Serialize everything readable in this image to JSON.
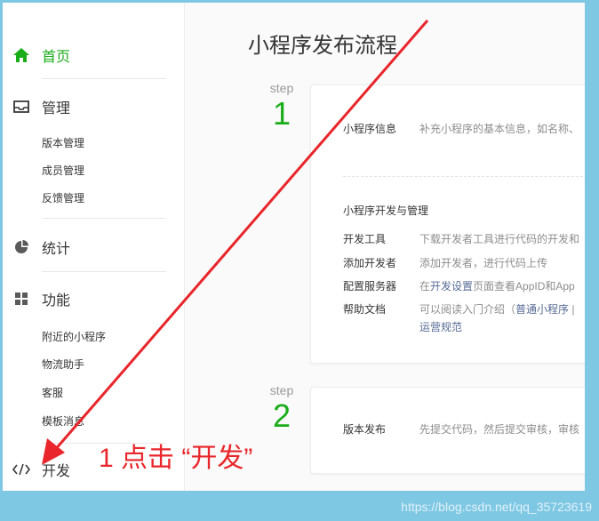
{
  "sidebar": {
    "home": {
      "label": "首页",
      "icon": "home-icon"
    },
    "manage": {
      "label": "管理",
      "icon": "inbox-icon"
    },
    "manage_items": [
      "版本管理",
      "成员管理",
      "反馈管理"
    ],
    "stats": {
      "label": "统计",
      "icon": "pie-chart-icon"
    },
    "features": {
      "label": "功能",
      "icon": "grid-icon"
    },
    "feature_items": [
      "附近的小程序",
      "物流助手",
      "客服",
      "模板消息"
    ],
    "develop": {
      "label": "开发",
      "icon": "code-icon"
    }
  },
  "main": {
    "title": "小程序发布流程",
    "steps": [
      {
        "label": "step",
        "number": "1",
        "info_key": "小程序信息",
        "info_value": "补充小程序的基本信息，如名称、",
        "section_title": "小程序开发与管理",
        "rows": [
          {
            "key": "开发工具",
            "value": "下载开发者工具进行代码的开发和"
          },
          {
            "key": "添加开发者",
            "value": "添加开发者，进行代码上传"
          },
          {
            "key": "配置服务器",
            "value_pre": "在",
            "value_link": "开发设置",
            "value_post": "页面查看AppID和App"
          },
          {
            "key": "帮助文档",
            "value_pre": "可以阅读入门介绍（",
            "value_link": "普通小程序",
            "value_post": "|",
            "value_line2": "运营规范"
          }
        ]
      },
      {
        "label": "step",
        "number": "2",
        "info_key": "版本发布",
        "info_value": "先提交代码，然后提交审核，审核"
      }
    ]
  },
  "annotation": {
    "text": "1 点击 “开发”",
    "color": "#e8262b"
  },
  "watermark": "https://blog.csdn.net/qq_35723619",
  "colors": {
    "accent": "#1aad19",
    "link": "#576b95",
    "annotation": "#e8262b"
  }
}
